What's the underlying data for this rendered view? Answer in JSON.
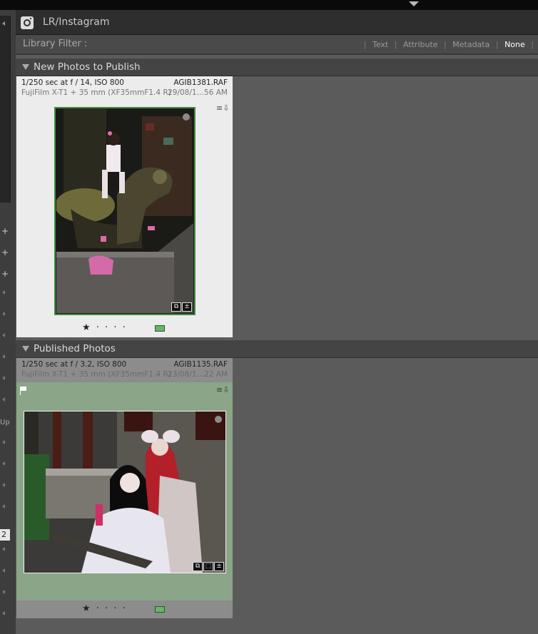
{
  "window": {
    "title": "LR/Instagram"
  },
  "filter_bar": {
    "label": "Library Filter :",
    "options": [
      "Text",
      "Attribute",
      "Metadata",
      "None"
    ],
    "selected": "None"
  },
  "sections": [
    {
      "title": "New Photos to Publish",
      "photo": {
        "exposure": "1/250 sec at f / 14, ISO 800",
        "camera": "FujiFilm X-T1 + 35 mm (XF35mmF1.4 R)",
        "filename": "AGIB1381.RAF",
        "date": "29/08/1…56 AM",
        "rating": "★ · · · ·",
        "color_label": "#6bb36b"
      }
    },
    {
      "title": "Published Photos",
      "photo": {
        "exposure": "1/250 sec at f / 3.2, ISO 800",
        "camera": "FujiFilm X-T1 + 35 mm (XF35mmF1.4 R)",
        "filename": "AGIB1135.RAF",
        "date": "23/08/1…22 AM",
        "rating": "★ · · · ·",
        "color_label": "#6bb36b"
      }
    }
  ],
  "left_panel": {
    "number_field": "2",
    "truncated_label": "Up"
  }
}
